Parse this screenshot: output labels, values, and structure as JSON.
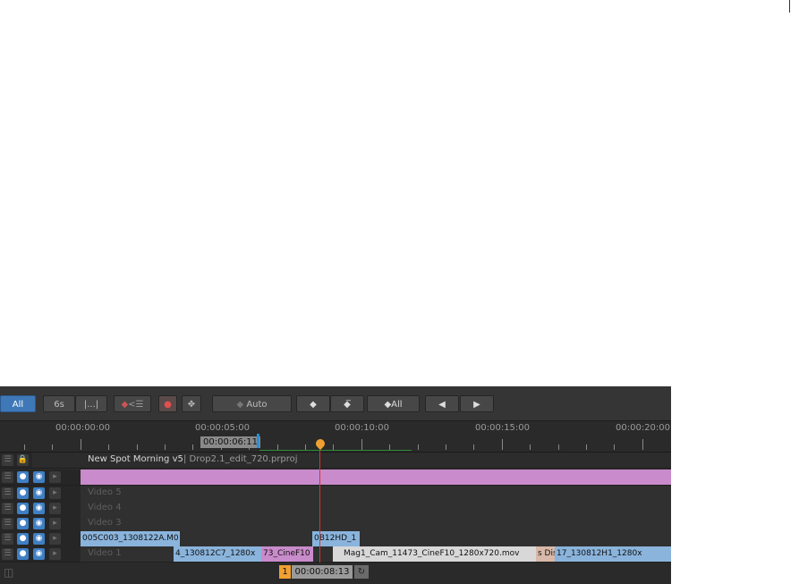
{
  "toolbar": {
    "all_label": "All",
    "six_s_label": "6s",
    "marker_label": "|...|",
    "auto_label": "Auto",
    "all_keyframes_label": "All"
  },
  "ruler": {
    "timecodes": [
      "00:00:00:00",
      "00:00:05:00",
      "00:00:10:00",
      "00:00:15:00",
      "00:00:20:00"
    ],
    "current_position": "00:00:06:11"
  },
  "sequence": {
    "name": "New Spot Morning v5",
    "project": " | Drop2.1_edit_720.prproj"
  },
  "tracks": {
    "v6": "",
    "v5": "Video 5",
    "v4": "Video 4",
    "v3": "Video 3",
    "v2": "",
    "v1": "Video 1"
  },
  "clips": {
    "v2_a": "005C003_1308122A.M0",
    "v2_b": "0B12HD_1",
    "v1_a": "4_130812C7_1280x",
    "v1_b": "73_CineF10",
    "v1_c": "Mag1_Cam_11473_CineF10_1280x720.mov",
    "v1_d": "s Dis",
    "v1_e": "17_130812H1_1280x"
  },
  "footer": {
    "track_number": "1",
    "timecode": "00:00:08:13"
  },
  "colors": {
    "accent_blue": "#3f78b7",
    "clip_blue": "#8ab4dc",
    "clip_pink": "#c98bcb",
    "playhead_orange": "#f0a030"
  }
}
